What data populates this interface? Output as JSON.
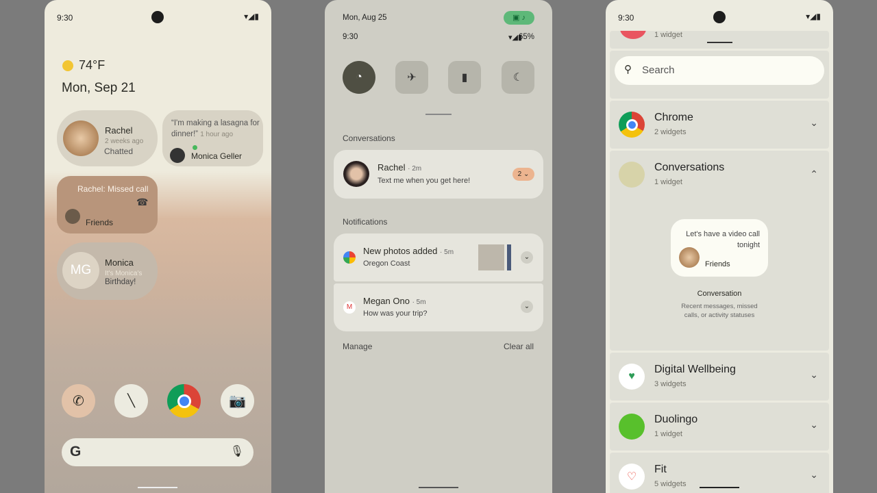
{
  "home": {
    "time": "9:30",
    "weather": "74°F",
    "date": "Mon, Sep 21",
    "w_rachel": {
      "name": "Rachel",
      "time": "2 weeks ago",
      "status": "Chatted"
    },
    "w_monica_quote": {
      "quote": "“I'm making a lasagna for dinner!”",
      "time": "1 hour ago",
      "name": "Monica Geller"
    },
    "w_missed": {
      "text": "Rachel: Missed call",
      "group": "Friends"
    },
    "w_monica": {
      "initials": "MG",
      "name": "Monica",
      "line1": "It's Monica's",
      "line2": "Birthday!"
    }
  },
  "shade": {
    "date": "Mon, Aug 25",
    "time": "9:30",
    "battery": "65%",
    "conversations_label": "Conversations",
    "conv": {
      "name": "Rachel",
      "time": "2m",
      "message": "Text me when you get here!",
      "count": "2"
    },
    "notifications_label": "Notifications",
    "notifs": [
      {
        "title": "New photos added",
        "time": "5m",
        "sub": "Oregon Coast"
      },
      {
        "title": "Megan Ono",
        "time": "5m",
        "sub": "How was your trip?"
      }
    ],
    "manage": "Manage",
    "clear_all": "Clear all"
  },
  "picker": {
    "time": "9:30",
    "top_partial": "1 widget",
    "search_placeholder": "Search",
    "apps": [
      {
        "name": "Chrome",
        "count": "2 widgets"
      },
      {
        "name": "Conversations",
        "count": "1 widget"
      },
      {
        "name": "Digital Wellbeing",
        "count": "3 widgets"
      },
      {
        "name": "Duolingo",
        "count": "1 widget"
      },
      {
        "name": "Fit",
        "count": "5 widgets"
      }
    ],
    "preview": {
      "message": "Let's have a video call tonight",
      "group": "Friends",
      "title": "Conversation",
      "desc": "Recent messages, missed calls, or activity statuses"
    }
  }
}
